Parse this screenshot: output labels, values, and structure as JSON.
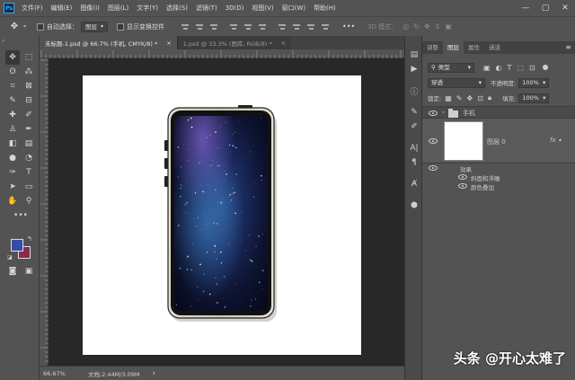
{
  "menu": {
    "logo": "Ps",
    "items": [
      "文件(F)",
      "编辑(E)",
      "图像(I)",
      "图层(L)",
      "文字(Y)",
      "选择(S)",
      "滤镜(T)",
      "3D(D)",
      "视图(V)",
      "窗口(W)",
      "帮助(H)"
    ],
    "minimize": "—",
    "maximize": "▢",
    "close": "✕"
  },
  "options": {
    "move_icon": "move-icon",
    "auto_select_label": "自动选择：",
    "auto_select_value": "图层",
    "transform_label": "显示变换控件",
    "more": "•••",
    "mode_3d": "3D 模式："
  },
  "tabs": [
    {
      "title": "未标题-1.psd @ 66.7% (手机, CMYK/8) *",
      "close": "×"
    },
    {
      "title": "1.psd @ 33.3% (图库, RGB/8) *",
      "close": "×"
    }
  ],
  "status": {
    "zoom": "66.67%",
    "doc_info": "文档:2.44M/3.09M",
    "arrow": "›"
  },
  "panel": {
    "tabs": [
      "调整",
      "图层",
      "属性",
      "通道"
    ],
    "active_tab": "图层",
    "kind_filter": "类型",
    "blend_mode": "穿透",
    "opacity_label": "不透明度:",
    "opacity_value": "100%",
    "lock_label": "锁定:",
    "fill_label": "填充:",
    "fill_value": "100%",
    "menu_icon": "≡"
  },
  "layers": [
    {
      "name": "手机",
      "type": "group"
    },
    {
      "name": "图层 0",
      "type": "layer",
      "fx": "fx"
    }
  ],
  "effects": {
    "header": "效果",
    "items": [
      "斜面和浮雕",
      "颜色叠加"
    ]
  },
  "colors": {
    "foreground": "#3a4aa8",
    "background": "#8b2a4a"
  },
  "watermark": "头条 @开心太难了"
}
